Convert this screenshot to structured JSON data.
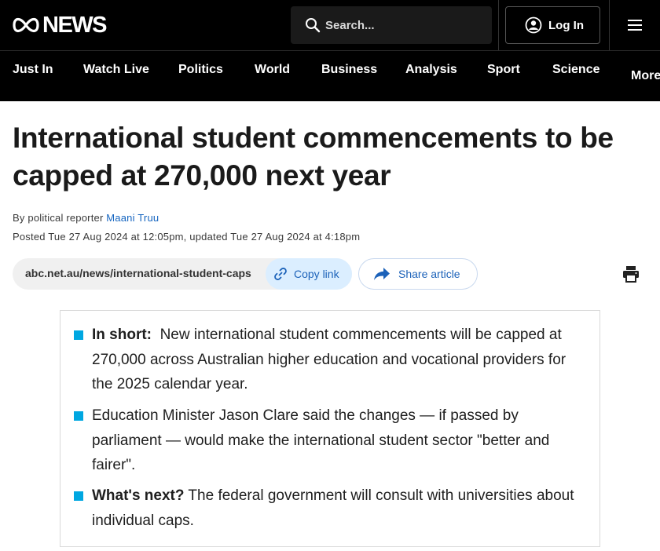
{
  "header": {
    "logo_text": "NEWS",
    "search_placeholder": "Search...",
    "login_label": "Log In"
  },
  "nav": {
    "items": [
      "Just In",
      "Watch Live",
      "Politics",
      "World",
      "Business",
      "Analysis",
      "Sport",
      "Science"
    ],
    "more_label": "More"
  },
  "article": {
    "headline": "International student commencements to be capped at 270,000 next year",
    "byline_prefix": "By political reporter",
    "author": "Maani Truu",
    "posted_label": "Posted",
    "posted_date": "Tue 27 Aug 2024 at 12:05pm",
    "updated_label": ", updated",
    "updated_date": "Tue 27 Aug 2024 at 4:18pm"
  },
  "share": {
    "url": "abc.net.au/news/international-student-caps",
    "copy_label": "Copy link",
    "share_label": "Share article"
  },
  "key_points": [
    {
      "lead": "In short:",
      "text": "New international student commencements will be capped at 270,000 across Australian higher education and vocational providers for the 2025 calendar year."
    },
    {
      "lead": "",
      "text": "Education Minister Jason Clare said the changes — if passed by parliament — would make the international student sector \"better and fairer\"."
    },
    {
      "lead": "What's next?",
      "text": "The federal government will consult with universities about individual caps."
    }
  ],
  "colors": {
    "header_bg": "#000000",
    "link_blue": "#1565c0",
    "bullet": "#00a7e1"
  }
}
